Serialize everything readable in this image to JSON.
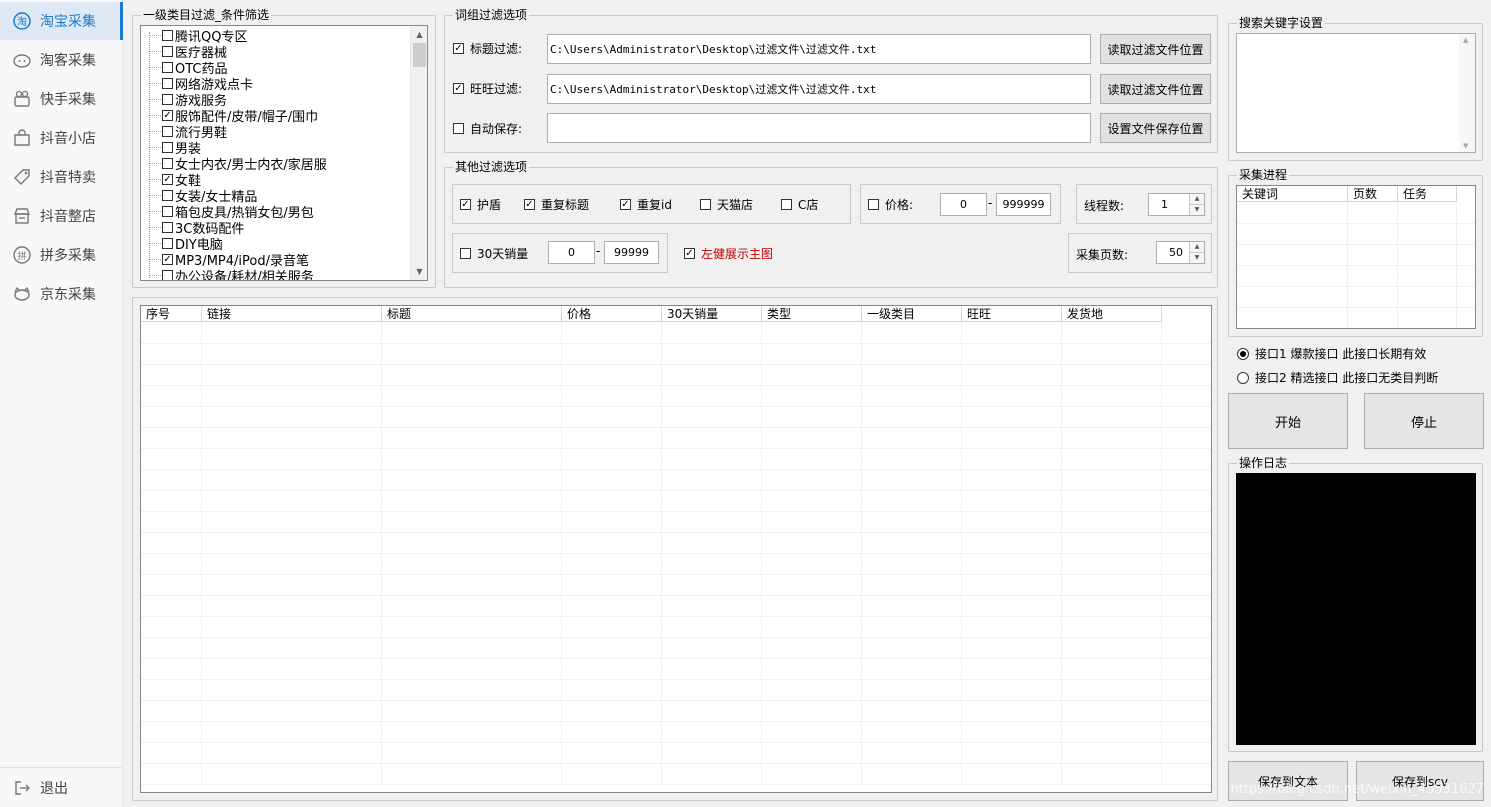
{
  "sidebar": {
    "items": [
      {
        "label": "淘宝采集",
        "icon": "taobao-icon",
        "active": true
      },
      {
        "label": "淘客采集",
        "icon": "taoke-icon",
        "active": false
      },
      {
        "label": "快手采集",
        "icon": "kuaishou-icon",
        "active": false
      },
      {
        "label": "抖音小店",
        "icon": "shop-bag-icon",
        "active": false
      },
      {
        "label": "抖音特卖",
        "icon": "tag-icon",
        "active": false
      },
      {
        "label": "抖音整店",
        "icon": "store-icon",
        "active": false
      },
      {
        "label": "拼多采集",
        "icon": "pinduoduo-icon",
        "active": false
      },
      {
        "label": "京东采集",
        "icon": "jd-dog-icon",
        "active": false
      }
    ],
    "exit_label": "退出"
  },
  "category_filter": {
    "title": "一级类目过滤_条件筛选",
    "items": [
      {
        "label": "腾讯QQ专区",
        "checked": false
      },
      {
        "label": "医疗器械",
        "checked": false
      },
      {
        "label": "OTC药品",
        "checked": false
      },
      {
        "label": "网络游戏点卡",
        "checked": false
      },
      {
        "label": "游戏服务",
        "checked": false
      },
      {
        "label": "服饰配件/皮带/帽子/围巾",
        "checked": true
      },
      {
        "label": "流行男鞋",
        "checked": false
      },
      {
        "label": "男装",
        "checked": false
      },
      {
        "label": "女士内衣/男士内衣/家居服",
        "checked": false
      },
      {
        "label": "女鞋",
        "checked": true
      },
      {
        "label": "女装/女士精品",
        "checked": false
      },
      {
        "label": "箱包皮具/热销女包/男包",
        "checked": false
      },
      {
        "label": "3C数码配件",
        "checked": false
      },
      {
        "label": "DIY电脑",
        "checked": false
      },
      {
        "label": "MP3/MP4/iPod/录音笔",
        "checked": true
      },
      {
        "label": "办公设备/耗材/相关服务",
        "checked": false
      }
    ]
  },
  "word_filter": {
    "title": "词组过滤选项",
    "rows": [
      {
        "label": "标题过滤:",
        "checked": true,
        "value": "C:\\Users\\Administrator\\Desktop\\过滤文件\\过滤文件.txt",
        "button": "读取过滤文件位置"
      },
      {
        "label": "旺旺过滤:",
        "checked": true,
        "value": "C:\\Users\\Administrator\\Desktop\\过滤文件\\过滤文件.txt",
        "button": "读取过滤文件位置"
      },
      {
        "label": "自动保存:",
        "checked": false,
        "value": "",
        "button": "设置文件保存位置"
      }
    ]
  },
  "other_filter": {
    "title": "其他过滤选项",
    "options": [
      {
        "label": "护盾",
        "checked": true
      },
      {
        "label": "重复标题",
        "checked": true
      },
      {
        "label": "重复id",
        "checked": true
      },
      {
        "label": "天猫店",
        "checked": false
      },
      {
        "label": "C店",
        "checked": false
      }
    ],
    "price": {
      "label": "价格:",
      "checked": false,
      "min": "0",
      "max": "999999"
    },
    "threads": {
      "label": "线程数:",
      "value": "1"
    },
    "sales30": {
      "label": "30天销量",
      "checked": false,
      "min": "0",
      "max": "99999"
    },
    "left_click": {
      "label": "左健展示主图",
      "checked": true,
      "color": "#c00000"
    },
    "pages": {
      "label": "采集页数:",
      "value": "50"
    },
    "dash": "-"
  },
  "results_table": {
    "columns": [
      "序号",
      "链接",
      "标题",
      "价格",
      "30天销量",
      "类型",
      "一级类目",
      "旺旺",
      "发货地"
    ],
    "rows": []
  },
  "search_keywords": {
    "title": "搜索关键字设置",
    "value": ""
  },
  "progress": {
    "title": "采集进程",
    "columns": [
      "关键词",
      "页数",
      "任务"
    ],
    "rows": []
  },
  "interfaces": [
    {
      "label": "接口1 爆款接口 此接口长期有效",
      "selected": true
    },
    {
      "label": "接口2 精选接口 此接口无类目判断",
      "selected": false
    }
  ],
  "actions": {
    "start": "开始",
    "stop": "停止"
  },
  "log": {
    "title": "操作日志"
  },
  "save": {
    "text": "保存到文本",
    "csv": "保存到scv"
  },
  "watermark": "https://blog.csdn.net/weixin_45531627",
  "colors": {
    "accent": "#1d7ad1",
    "log_bg": "#000000",
    "warning_text": "#c00000"
  }
}
